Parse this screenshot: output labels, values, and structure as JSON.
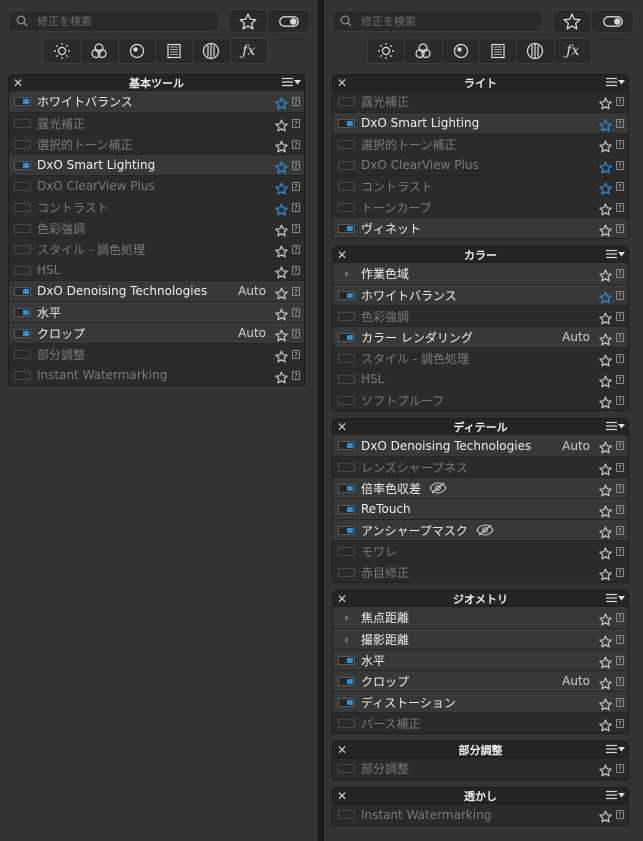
{
  "search": {
    "placeholder": "修正を検索"
  },
  "left": {
    "groups": [
      {
        "title": "基本ツール",
        "items": [
          {
            "label": "ホワイトバランス",
            "enabled": true,
            "active": true,
            "fav": true
          },
          {
            "label": "露光補正",
            "enabled": false,
            "fav": false
          },
          {
            "label": "選択的トーン補正",
            "enabled": false,
            "fav": false
          },
          {
            "label": "DxO Smart Lighting",
            "enabled": true,
            "active": true,
            "fav": true
          },
          {
            "label": "DxO ClearView Plus",
            "enabled": false,
            "fav": true
          },
          {
            "label": "コントラスト",
            "enabled": false,
            "fav": true
          },
          {
            "label": "色彩強調",
            "enabled": false,
            "fav": false
          },
          {
            "label": "スタイル - 調色処理",
            "enabled": false,
            "fav": false
          },
          {
            "label": "HSL",
            "enabled": false,
            "fav": false
          },
          {
            "label": "DxO Denoising Technologies",
            "enabled": true,
            "active": true,
            "auto": "Auto",
            "fav": false
          },
          {
            "label": "水平",
            "enabled": true,
            "active": true,
            "fav": false
          },
          {
            "label": "クロップ",
            "enabled": true,
            "active": true,
            "auto": "Auto",
            "fav": false
          },
          {
            "label": "部分調整",
            "enabled": false,
            "fav": false
          },
          {
            "label": "Instant Watermarking",
            "enabled": false,
            "fav": false
          }
        ]
      }
    ]
  },
  "right": {
    "groups": [
      {
        "title": "ライト",
        "items": [
          {
            "label": "露光補正",
            "enabled": false,
            "fav": false
          },
          {
            "label": "DxO Smart Lighting",
            "enabled": true,
            "active": true,
            "fav": true
          },
          {
            "label": "選択的トーン補正",
            "enabled": false,
            "fav": false
          },
          {
            "label": "DxO ClearView Plus",
            "enabled": false,
            "fav": true
          },
          {
            "label": "コントラスト",
            "enabled": false,
            "fav": true
          },
          {
            "label": "トーンカーブ",
            "enabled": false,
            "fav": false
          },
          {
            "label": "ヴィネット",
            "enabled": true,
            "active": true,
            "fav": false
          }
        ]
      },
      {
        "title": "カラー",
        "items": [
          {
            "label": "作業色域",
            "chevron": true,
            "active": true,
            "fav": false
          },
          {
            "label": "ホワイトバランス",
            "enabled": true,
            "active": true,
            "fav": true
          },
          {
            "label": "色彩強調",
            "enabled": false,
            "fav": false
          },
          {
            "label": "カラー レンダリング",
            "enabled": true,
            "active": true,
            "auto": "Auto",
            "fav": false
          },
          {
            "label": "スタイル - 調色処理",
            "enabled": false,
            "fav": false
          },
          {
            "label": "HSL",
            "enabled": false,
            "fav": false
          },
          {
            "label": "ソフトプルーフ",
            "enabled": false,
            "fav": false
          }
        ]
      },
      {
        "title": "ディテール",
        "items": [
          {
            "label": "DxO Denoising Technologies",
            "enabled": true,
            "active": true,
            "auto": "Auto",
            "fav": false
          },
          {
            "label": "レンズシャープネス",
            "enabled": false,
            "fav": false
          },
          {
            "label": "倍率色収差",
            "enabled": true,
            "active": true,
            "eye": true,
            "fav": false
          },
          {
            "label": "ReTouch",
            "enabled": true,
            "active": true,
            "fav": false
          },
          {
            "label": "アンシャープマスク",
            "enabled": true,
            "active": true,
            "eye": true,
            "fav": false
          },
          {
            "label": "モワレ",
            "enabled": false,
            "fav": false
          },
          {
            "label": "赤目修正",
            "enabled": false,
            "fav": false
          }
        ]
      },
      {
        "title": "ジオメトリ",
        "items": [
          {
            "label": "焦点距離",
            "chevron": true,
            "active": true,
            "fav": false
          },
          {
            "label": "撮影距離",
            "chevron": true,
            "active": true,
            "fav": false
          },
          {
            "label": "水平",
            "enabled": true,
            "active": true,
            "fav": false
          },
          {
            "label": "クロップ",
            "enabled": true,
            "active": true,
            "auto": "Auto",
            "fav": false
          },
          {
            "label": "ディストーション",
            "enabled": true,
            "active": true,
            "fav": false
          },
          {
            "label": "パース補正",
            "enabled": false,
            "fav": false
          }
        ]
      },
      {
        "title": "部分調整",
        "items": [
          {
            "label": "部分調整",
            "enabled": false,
            "fav": false
          }
        ]
      },
      {
        "title": "透かし",
        "items": [
          {
            "label": "Instant Watermarking",
            "enabled": false,
            "fav": false
          }
        ]
      }
    ]
  },
  "colors": {
    "accent": "#2c8fd9",
    "panel": "#333333",
    "row": "#2b2b2b"
  }
}
